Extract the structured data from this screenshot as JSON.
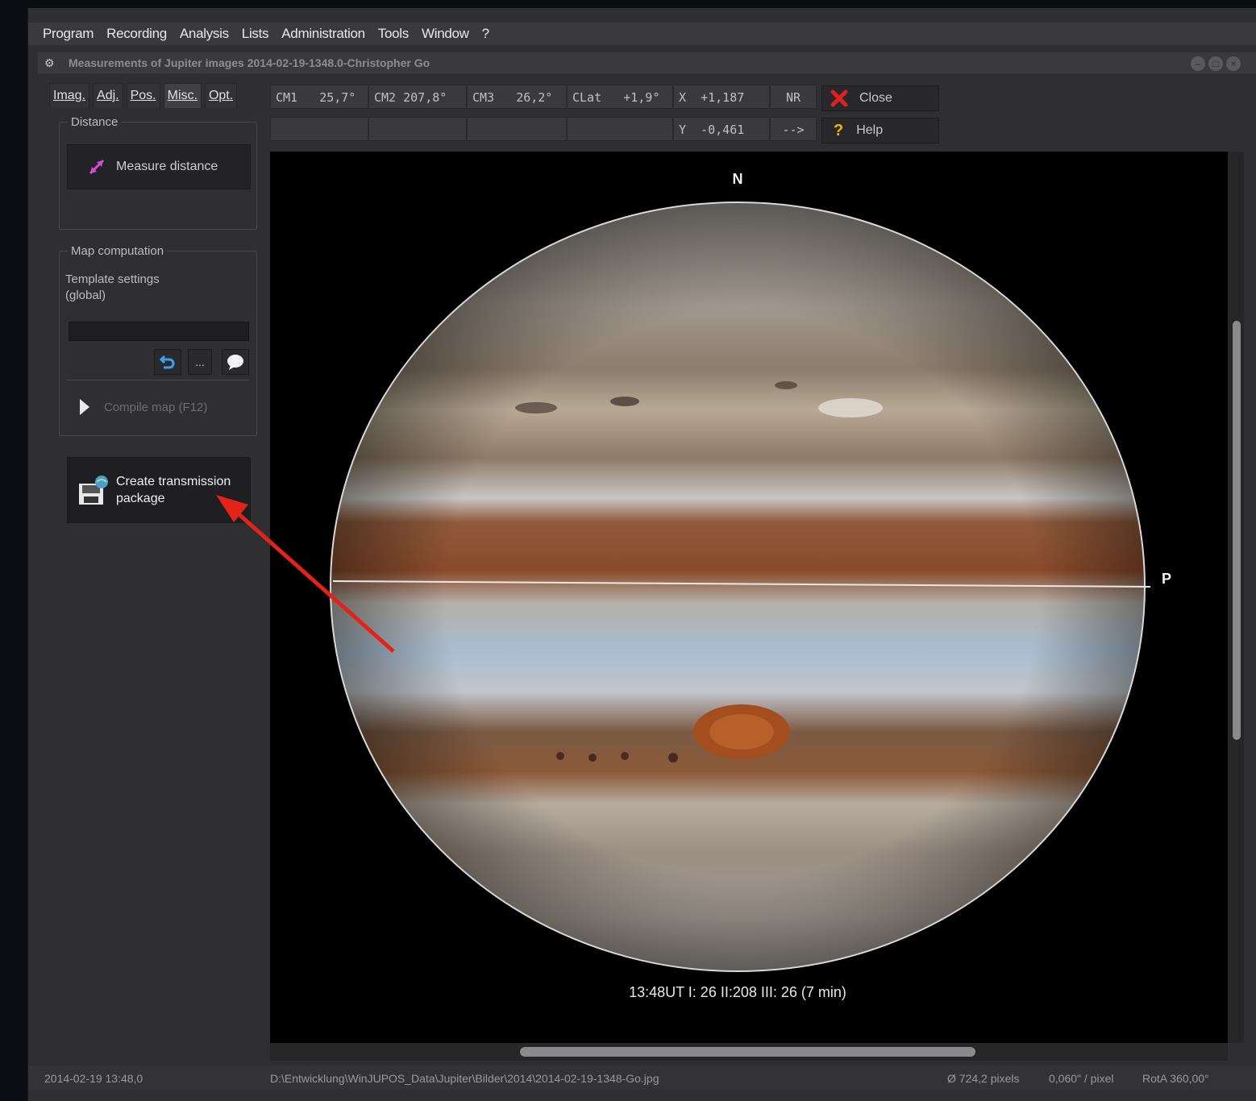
{
  "menu": [
    "Program",
    "Recording",
    "Analysis",
    "Lists",
    "Administration",
    "Tools",
    "Window",
    "?"
  ],
  "window": {
    "title": "Measurements of Jupiter images  2014-02-19-1348.0-Christopher Go"
  },
  "tabs": [
    "Imag.",
    "Adj.",
    "Pos.",
    "Misc.",
    "Opt."
  ],
  "active_tab": "Misc.",
  "distance": {
    "legend": "Distance",
    "measure_label": "Measure distance"
  },
  "map": {
    "legend": "Map computation",
    "template_label": "Template settings\n(global)",
    "template_value": "",
    "more_label": "...",
    "compile_label": "Compile map (F12)"
  },
  "transmission": {
    "label": "Create transmission\npackage"
  },
  "coords": {
    "cm1_label": "CM1",
    "cm1_value": "25,7°",
    "cm2_label": "CM2",
    "cm2_value": "207,8°",
    "cm3_label": "CM3",
    "cm3_value": "26,2°",
    "clat_label": "CLat",
    "clat_value": "+1,9°",
    "x_label": "X",
    "x_value": "+1,187",
    "y_label": "Y",
    "y_value": "-0,461",
    "nr_label": "NR",
    "arrow_label": "-->"
  },
  "buttons": {
    "close_label": "Close",
    "help_label": "Help"
  },
  "image": {
    "north_label": "N",
    "p_label": "P",
    "caption": "13:48UT  I: 26  II:208  III: 26  (7 min)"
  },
  "status": {
    "datetime": "2014-02-19  13:48,0",
    "path": "D:\\Entwicklung\\WinJUPOS_Data\\Jupiter\\Bilder\\2014\\2014-02-19-1348-Go.jpg",
    "diameter": "Ø 724,2 pixels",
    "scale": "0,060\" / pixel",
    "rota": "RotA 360,00°"
  },
  "colors": {
    "annotation_arrow": "#e3231a",
    "close_icon": "#e02020",
    "help_icon": "#f0b400"
  }
}
